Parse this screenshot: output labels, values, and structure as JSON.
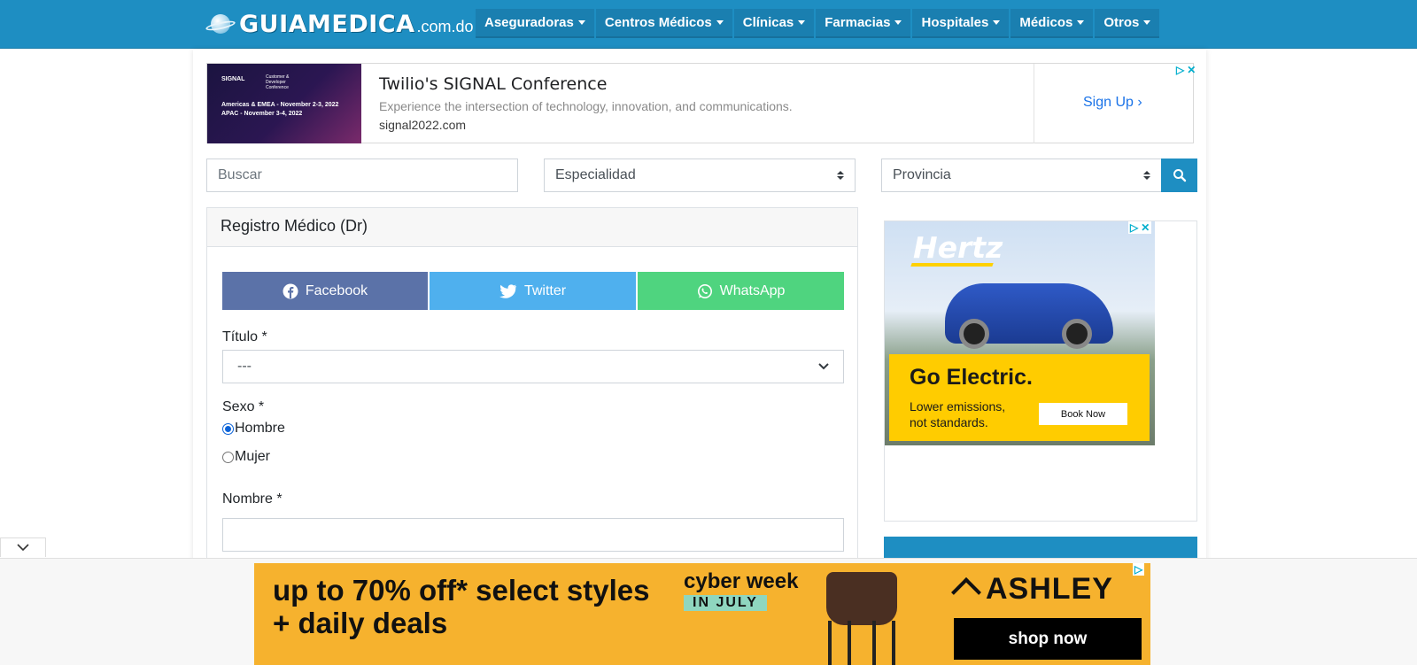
{
  "header": {
    "logo_main": "GUIAMEDICA",
    "logo_sub": ".com.do",
    "nav": [
      {
        "label": "Aseguradoras"
      },
      {
        "label": "Centros Médicos"
      },
      {
        "label": "Clínicas"
      },
      {
        "label": "Farmacias"
      },
      {
        "label": "Hospitales"
      },
      {
        "label": "Médicos"
      },
      {
        "label": "Otros"
      }
    ]
  },
  "top_ad": {
    "title": "Twilio's SIGNAL Conference",
    "description": "Experience the intersection of technology, innovation, and communications.",
    "url": "signal2022.com",
    "cta": "Sign Up",
    "image_brand": "SIGNAL",
    "image_tag": "Customer & Developer Conference",
    "image_line1": "Americas & EMEA - November 2-3, 2022",
    "image_line2": "APAC - November 3-4, 2022"
  },
  "search": {
    "placeholder": "Buscar",
    "specialty": "Especialidad",
    "province": "Provincia"
  },
  "form": {
    "card_title": "Registro Médico (Dr)",
    "share": {
      "facebook": "Facebook",
      "twitter": "Twitter",
      "whatsapp": "WhatsApp"
    },
    "titulo_label": "Título *",
    "titulo_value": "---",
    "sexo_label": "Sexo *",
    "radio_hombre": "Hombre",
    "radio_mujer": "Mujer",
    "nombre_label": "Nombre *"
  },
  "side_ad": {
    "brand": "Hertz",
    "headline": "Go Electric.",
    "body": "Lower emissions, not standards.",
    "cta": "Book Now"
  },
  "bottom_ad": {
    "line1": "up to 70% off* select styles",
    "line2": "+ daily deals",
    "promo": "cyber week",
    "promo_sub": "IN JULY",
    "brand": "ASHLEY",
    "cta": "shop now"
  },
  "colors": {
    "primary": "#1e8ec2",
    "facebook": "#5b72a8",
    "twitter": "#4fb0ee",
    "whatsapp": "#4fd47f"
  }
}
